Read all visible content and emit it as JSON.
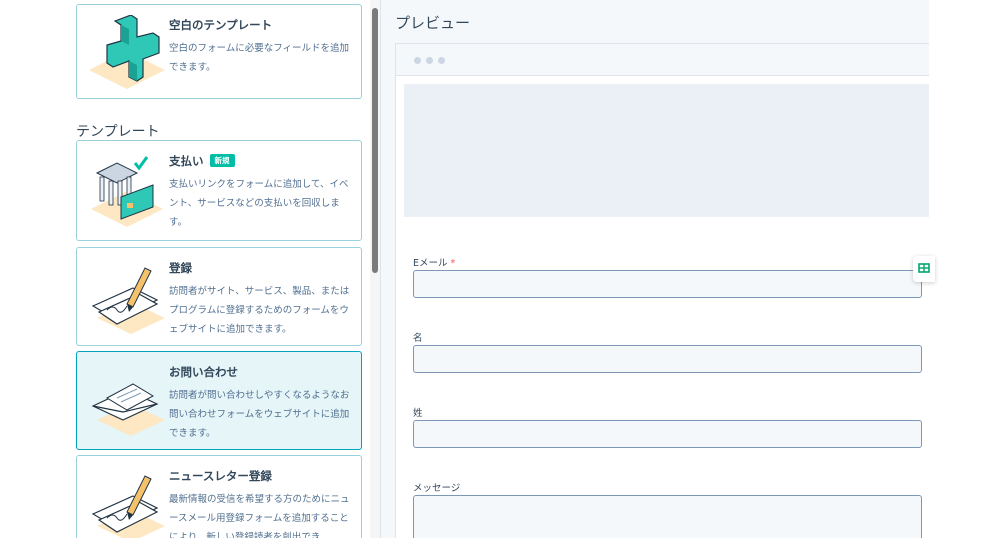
{
  "blank_template": {
    "title": "空白のテンプレート",
    "description": "空白のフォームに必要なフィールドを追加できます。"
  },
  "templates_heading": "テンプレート",
  "templates": [
    {
      "title": "支払い",
      "badge": "新規",
      "description": "支払いリンクをフォームに追加して、イベント、サービスなどの支払いを回収します。",
      "icon": "payment-bank-card-illustration"
    },
    {
      "title": "登録",
      "description": "訪問者がサイト、サービス、製品、またはプログラムに登録するためのフォームをウェブサイトに追加できます。",
      "icon": "pen-signing-document-illustration"
    },
    {
      "title": "お問い合わせ",
      "description": "訪問者が問い合わせしやすくなるようなお問い合わせフォームをウェブサイトに追加できます。",
      "icon": "envelope-illustration",
      "selected": true
    },
    {
      "title": "ニュースレター登録",
      "description": "最新情報の受信を希望する方のためにニュースメール用登録フォームを追加することにより、新しい登録読者を創出でき",
      "icon": "pen-signing-document-illustration"
    }
  ],
  "preview": {
    "title": "プレビュー",
    "fields": [
      {
        "label": "Eメール",
        "required": "*"
      },
      {
        "label": "名"
      },
      {
        "label": "姓"
      },
      {
        "label": "メッセージ"
      }
    ]
  },
  "colors": {
    "accent": "#00a4bd",
    "card_border": "#99d2dc",
    "selected_bg": "#e5f5f8",
    "badge": "#00bda5",
    "text": "#33475b"
  }
}
